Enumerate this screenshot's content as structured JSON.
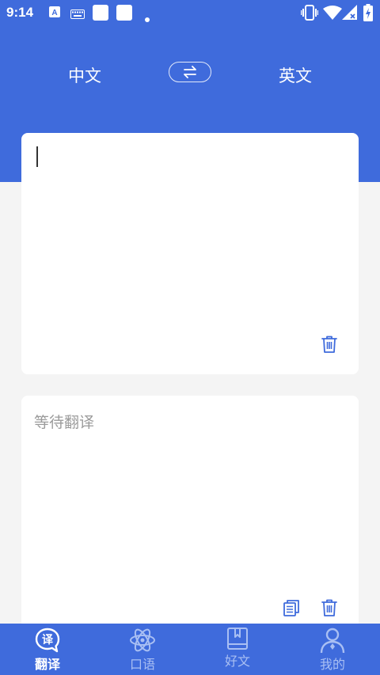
{
  "status_bar": {
    "time": "9:14",
    "icons": [
      "a-icon",
      "keyboard-icon",
      "notification-square-icon",
      "notification-square-icon",
      "dot-icon",
      "vibrate-icon",
      "wifi-icon",
      "signal-icon",
      "battery-charging-icon"
    ]
  },
  "language_bar": {
    "source_language": "中文",
    "target_language": "英文",
    "swap_icon": "swap-arrows-icon"
  },
  "input_card": {
    "value": "",
    "delete_icon": "trash-icon"
  },
  "output_card": {
    "placeholder": "等待翻译",
    "copy_icon": "copy-icon",
    "delete_icon": "trash-icon"
  },
  "bottom_nav": {
    "items": [
      {
        "label": "翻译",
        "icon": "translate-icon",
        "active": true
      },
      {
        "label": "口语",
        "icon": "atom-icon",
        "active": false
      },
      {
        "label": "好文",
        "icon": "book-icon",
        "active": false
      },
      {
        "label": "我的",
        "icon": "person-icon",
        "active": false
      }
    ]
  },
  "colors": {
    "primary": "#3f6bdc",
    "background": "#f4f4f4",
    "card": "#ffffff",
    "placeholder": "#9b9b9b",
    "nav_inactive": "#a9bff3"
  }
}
